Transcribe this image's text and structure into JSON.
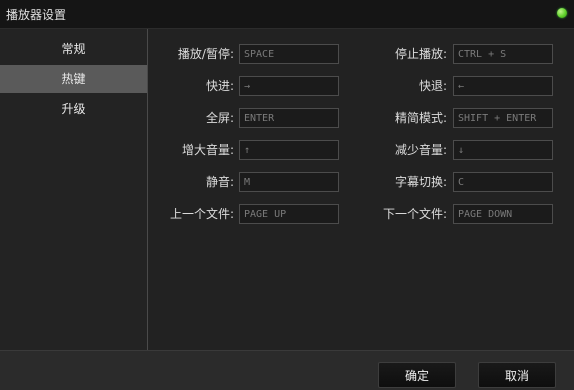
{
  "window": {
    "title": "播放器设置"
  },
  "sidebar": {
    "items": [
      {
        "label": "常规"
      },
      {
        "label": "热键"
      },
      {
        "label": "升级"
      }
    ]
  },
  "hotkeys": {
    "left": [
      {
        "label": "播放/暂停:",
        "value": "SPACE"
      },
      {
        "label": "快进:",
        "value": "→"
      },
      {
        "label": "全屏:",
        "value": "ENTER"
      },
      {
        "label": "增大音量:",
        "value": "↑"
      },
      {
        "label": "静音:",
        "value": "M"
      },
      {
        "label": "上一个文件:",
        "value": "PAGE UP"
      }
    ],
    "right": [
      {
        "label": "停止播放:",
        "value": "CTRL + S"
      },
      {
        "label": "快退:",
        "value": "←"
      },
      {
        "label": "精简模式:",
        "value": "SHIFT + ENTER"
      },
      {
        "label": "减少音量:",
        "value": "↓"
      },
      {
        "label": "字幕切换:",
        "value": "C"
      },
      {
        "label": "下一个文件:",
        "value": "PAGE DOWN"
      }
    ]
  },
  "footer": {
    "ok_label": "确定",
    "cancel_label": "取消"
  }
}
